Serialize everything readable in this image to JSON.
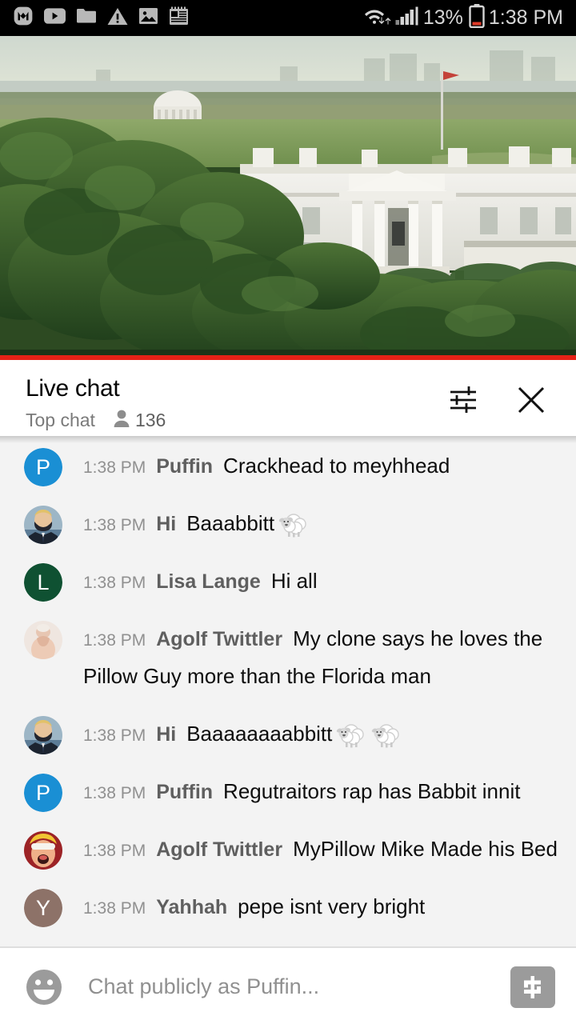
{
  "statusbar": {
    "left_icons": [
      {
        "name": "mega-app-icon",
        "glyph": "M"
      },
      {
        "name": "youtube-icon",
        "glyph": "▶"
      },
      {
        "name": "folder-icon",
        "glyph": "📁"
      },
      {
        "name": "warning-triangle-icon",
        "glyph": "⚠"
      },
      {
        "name": "image-icon",
        "glyph": "🖼"
      },
      {
        "name": "notepad-icon",
        "glyph": "🗒"
      }
    ],
    "wifi_icon": "wifi-data-transfer-icon",
    "signal_icon": "cell-signal-icon",
    "battery_percent": "13%",
    "battery_icon": "battery-low-icon",
    "clock": "1:38 PM"
  },
  "video": {
    "alt": "Live webcam view of the White House North Portico in Washington DC with trees and the Jefferson Memorial in the distance",
    "progress_percent": 100,
    "progress_color": "#e62117"
  },
  "chat_header": {
    "title": "Live chat",
    "subtitle": "Top chat",
    "viewer_count": "136",
    "viewer_icon": "person-icon",
    "settings_icon": "tune-sliders-icon",
    "close_icon": "close-x-icon"
  },
  "messages": [
    {
      "time": "1:38 PM",
      "author": "Puffin",
      "text": "Crackhead to meyhhead",
      "avatar": {
        "type": "letter",
        "letter": "P",
        "color": "#1a8fd4"
      },
      "emojis": 0
    },
    {
      "time": "1:38 PM",
      "author": "Hi",
      "text": "Baaabbitt",
      "avatar": {
        "type": "photo",
        "kind": "masked-man-photo",
        "color": "#7f9cb3"
      },
      "emojis": 1
    },
    {
      "time": "1:38 PM",
      "author": "Lisa Lange",
      "text": "Hi all",
      "avatar": {
        "type": "letter",
        "letter": "L",
        "color": "#0f5132"
      },
      "emojis": 0
    },
    {
      "time": "1:38 PM",
      "author": "Agolf Twittler",
      "text": "My clone says he loves the Pillow Guy more than the Florida man",
      "avatar": {
        "type": "photo",
        "kind": "pale-figure-photo",
        "color": "#e7d6cc"
      },
      "emojis": 0
    },
    {
      "time": "1:38 PM",
      "author": "Hi",
      "text": "Baaaaaaaabbitt",
      "avatar": {
        "type": "photo",
        "kind": "masked-man-photo",
        "color": "#7f9cb3"
      },
      "emojis": 2
    },
    {
      "time": "1:38 PM",
      "author": "Puffin",
      "text": "Regutraitors rap has Babbit innit",
      "avatar": {
        "type": "letter",
        "letter": "P",
        "color": "#1a8fd4"
      },
      "emojis": 0
    },
    {
      "time": "1:38 PM",
      "author": "Agolf Twittler",
      "text": "MyPillow Mike Made his Bed",
      "avatar": {
        "type": "photo",
        "kind": "cartoon-face-photo",
        "color": "#b5282a"
      },
      "emojis": 0
    },
    {
      "time": "1:38 PM",
      "author": "Yahhah",
      "text": "pepe isnt very bright",
      "avatar": {
        "type": "letter",
        "letter": "Y",
        "color": "#8d7268"
      },
      "emojis": 0
    }
  ],
  "input_bar": {
    "emoji_icon": "emoji-smiley-icon",
    "placeholder": "Chat publicly as Puffin...",
    "value": "",
    "superchat_icon": "dollar-sign-icon"
  }
}
